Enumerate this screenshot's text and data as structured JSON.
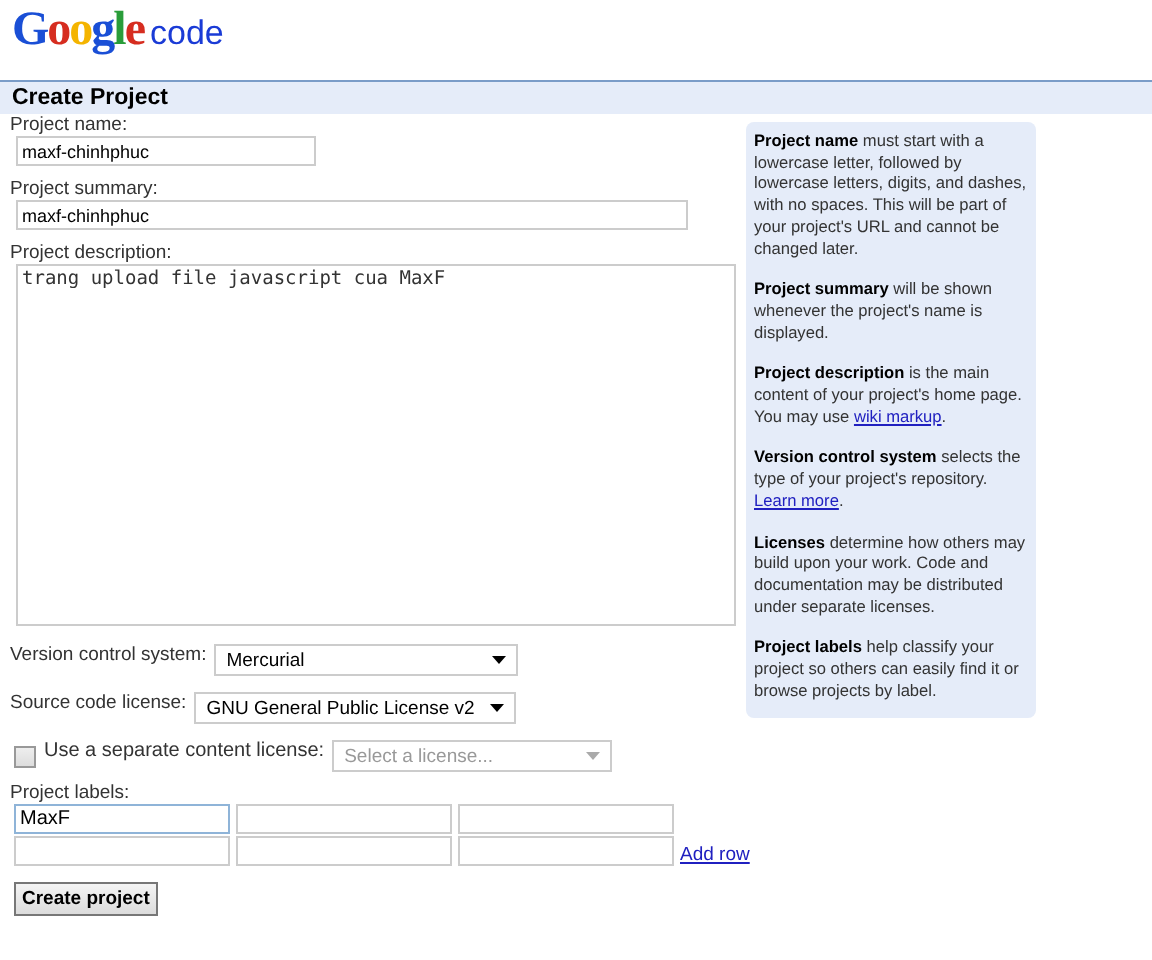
{
  "logo": {
    "brand": "Google",
    "product": "code"
  },
  "heading": "Create Project",
  "fields": [
    {
      "kind": "short_input",
      "label": "Project name:",
      "value": "maxf-chinhphuc"
    },
    {
      "kind": "long_input",
      "label": "Project summary:",
      "value": "maxf-chinhphuc"
    },
    {
      "kind": "textarea",
      "label": "Project description:",
      "value": "trang upload file javascript cua MaxF"
    }
  ],
  "selects": [
    {
      "label": "Version control system:",
      "value": "Mercurial"
    },
    {
      "label": "Source code license:",
      "value": "GNU General Public License v2"
    }
  ],
  "content_license": {
    "label": "Use a separate content license:",
    "checked": false,
    "placeholder": "Select a license...",
    "disabled": true
  },
  "labels": {
    "label": "Project labels:",
    "rows": [
      [
        "MaxF",
        null,
        null
      ],
      [
        null,
        null,
        null
      ]
    ],
    "add_row": "Add row"
  },
  "submit": "Create project",
  "help": [
    [
      {
        "kind": "bold",
        "text": "Project name"
      },
      {
        "kind": "plain",
        "text": " must start with a lowercase letter, followed by lowercase letters, digits, and dashes, with no spaces. This will be part of your project's URL and cannot be changed later."
      }
    ],
    [
      {
        "kind": "bold",
        "text": "Project summary"
      },
      {
        "kind": "plain",
        "text": " will be shown whenever the project's name is displayed."
      }
    ],
    [
      {
        "kind": "bold",
        "text": "Project description"
      },
      {
        "kind": "plain",
        "text": " is the main content of your project's home page. You may use "
      },
      {
        "kind": "link",
        "text": "wiki markup"
      },
      {
        "kind": "plain",
        "text": "."
      }
    ],
    [
      {
        "kind": "bold",
        "text": "Version control system"
      },
      {
        "kind": "plain",
        "text": " selects the type of your project's repository. "
      },
      {
        "kind": "link",
        "text": "Learn more"
      },
      {
        "kind": "plain",
        "text": "."
      }
    ],
    [
      {
        "kind": "bold",
        "text": "Licenses"
      },
      {
        "kind": "plain",
        "text": " determine how others may build upon your work. Code and documentation may be distributed under separate licenses."
      }
    ],
    [
      {
        "kind": "bold",
        "text": "Project labels"
      },
      {
        "kind": "plain",
        "text": " help classify your project so others can easily find it or browse projects by label."
      }
    ]
  ]
}
